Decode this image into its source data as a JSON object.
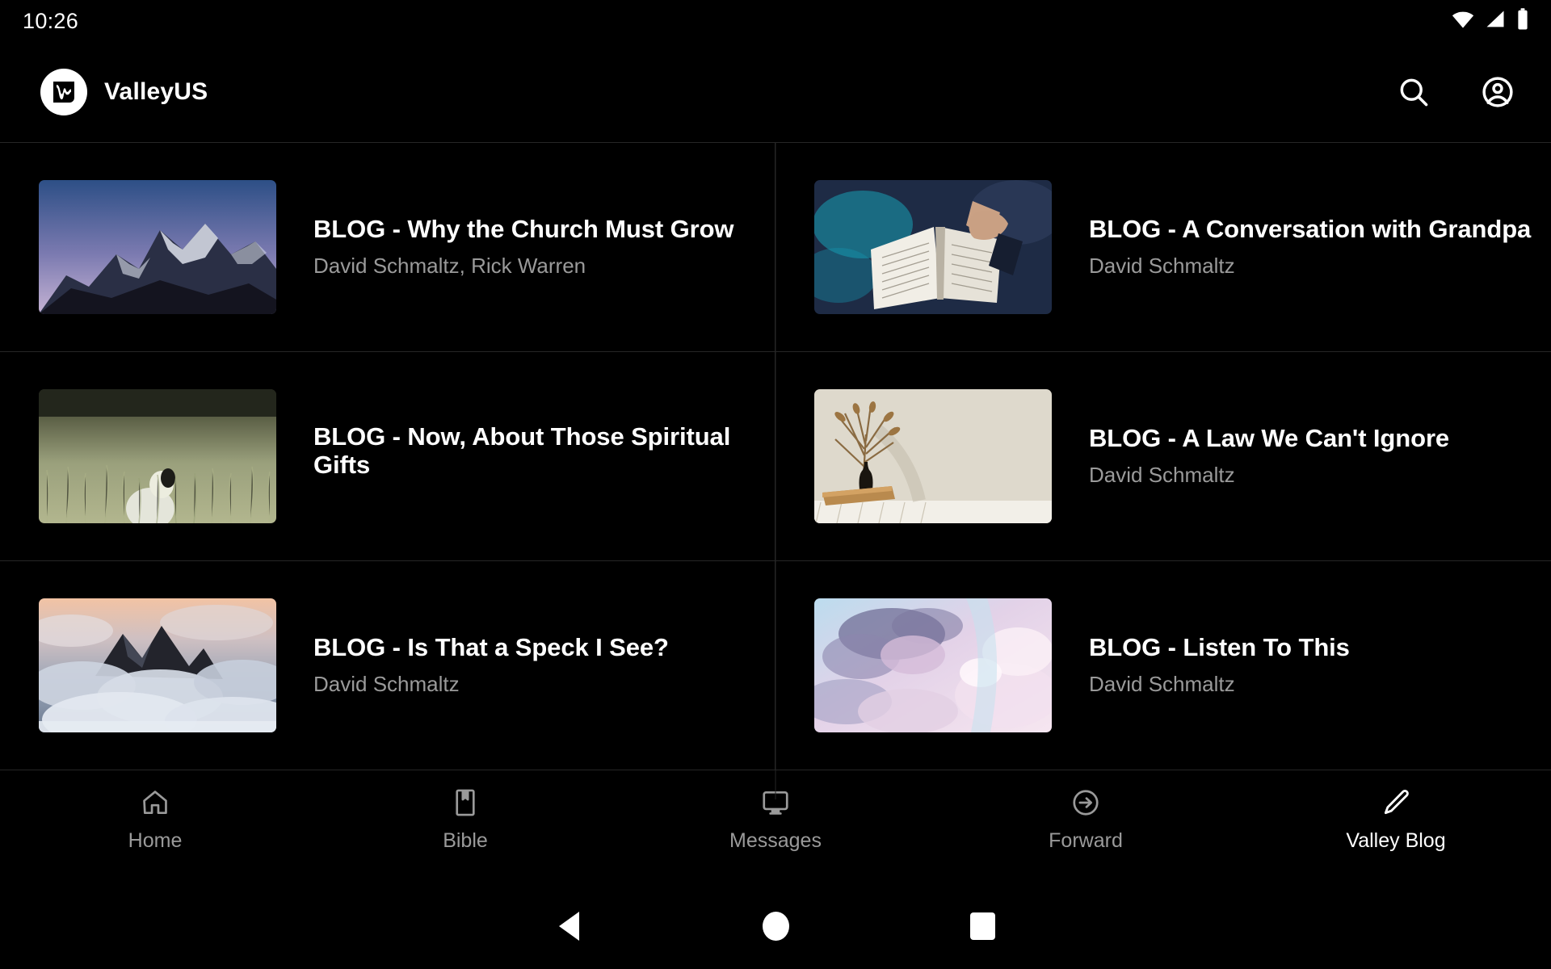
{
  "statusbar": {
    "time": "10:26",
    "icons": [
      "wifi-icon",
      "cellular-signal-icon",
      "battery-icon"
    ]
  },
  "appbar": {
    "brand_name": "ValleyUS",
    "logo_icon": "valleyus-logo-icon",
    "actions": [
      {
        "name": "search-icon",
        "label": "Search"
      },
      {
        "name": "account-circle-icon",
        "label": "Account"
      }
    ]
  },
  "colors": {
    "background": "#000000",
    "title_text": "#ffffff",
    "secondary_text": "#9a9a9a",
    "divider": "#262626",
    "accent": "#ffffff"
  },
  "main": {
    "cards": [
      {
        "title": "BLOG - Why the Church Must Grow",
        "author": "David Schmaltz, Rick Warren",
        "thumbnail": "snow-capped-mountain-at-dusk"
      },
      {
        "title": "BLOG - A Conversation with Grandpa",
        "author": "David Schmaltz",
        "thumbnail": "hands-holding-open-bible"
      },
      {
        "title": "BLOG - Now, About Those Spiritual Gifts",
        "author": "",
        "thumbnail": "sheep-in-tall-grass-field"
      },
      {
        "title": "BLOG - A Law We Can't Ignore",
        "author": "David Schmaltz",
        "thumbnail": "vase-with-dried-palm-on-shelf"
      },
      {
        "title": "BLOG - Is That a Speck I See?",
        "author": "David Schmaltz",
        "thumbnail": "mountain-peaks-above-clouds"
      },
      {
        "title": "BLOG - Listen To This",
        "author": "David Schmaltz",
        "thumbnail": "pastel-pink-clouds-sky"
      }
    ]
  },
  "tabbar": {
    "items": [
      {
        "label": "Home",
        "icon": "home-icon",
        "active": false
      },
      {
        "label": "Bible",
        "icon": "book-bookmark-icon",
        "active": false
      },
      {
        "label": "Messages",
        "icon": "monitor-screen-icon",
        "active": false
      },
      {
        "label": "Forward",
        "icon": "arrow-forward-circle-icon",
        "active": false
      },
      {
        "label": "Valley Blog",
        "icon": "pencil-edit-icon",
        "active": true
      }
    ]
  },
  "sysnav": {
    "buttons": [
      {
        "name": "android-back-button",
        "label": "Back"
      },
      {
        "name": "android-home-button",
        "label": "Home"
      },
      {
        "name": "android-recents-button",
        "label": "Recents"
      }
    ]
  }
}
